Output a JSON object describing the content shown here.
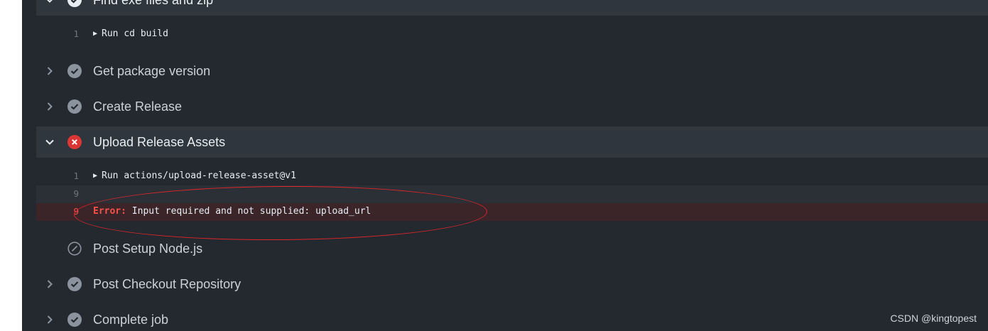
{
  "steps": {
    "find_exe": {
      "label": "Find exe files and zip",
      "expanded": true,
      "status": "success"
    },
    "find_exe_log": [
      {
        "num": "1",
        "text": "Run cd build"
      }
    ],
    "get_version": {
      "label": "Get package version",
      "status": "success"
    },
    "create_release": {
      "label": "Create Release",
      "status": "success"
    },
    "upload_assets": {
      "label": "Upload Release Assets",
      "expanded": true,
      "status": "failure"
    },
    "upload_log": [
      {
        "num": "1",
        "text": "Run actions/upload-release-asset@v1"
      },
      {
        "num": "9",
        "text": ""
      },
      {
        "num": "9",
        "keyword": "Error:",
        "text": "Input required and not supplied: upload_url"
      }
    ],
    "post_setup_node": {
      "label": "Post Setup Node.js",
      "status": "skipped"
    },
    "post_checkout": {
      "label": "Post Checkout Repository",
      "status": "success"
    },
    "complete_job": {
      "label": "Complete job",
      "status": "success"
    }
  },
  "watermark": "CSDN @kingtopest",
  "colors": {
    "success": "#8b949e",
    "failure": "#da3633",
    "error_bg": "#3b2529",
    "annotation": "#e0262b"
  }
}
